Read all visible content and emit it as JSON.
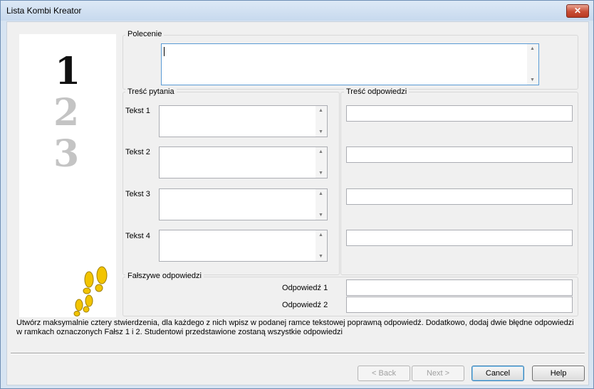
{
  "window": {
    "title": "Lista Kombi Kreator",
    "close_glyph": "✕"
  },
  "image_panel": {
    "digits": [
      "1",
      "2",
      "3"
    ]
  },
  "command": {
    "group_label": "Polecenie",
    "value": ""
  },
  "questions": {
    "group_label": "Treść pytania",
    "items": [
      {
        "label": "Tekst 1",
        "value": ""
      },
      {
        "label": "Tekst 2",
        "value": ""
      },
      {
        "label": "Tekst 3",
        "value": ""
      },
      {
        "label": "Tekst 4",
        "value": ""
      }
    ]
  },
  "answers": {
    "group_label": "Treść odpowiedzi",
    "values": [
      "",
      "",
      "",
      ""
    ]
  },
  "false_answers": {
    "group_label": "Fałszywe odpowiedzi",
    "items": [
      {
        "label": "Odpowiedź 1",
        "value": ""
      },
      {
        "label": "Odpowiedź 2",
        "value": ""
      }
    ]
  },
  "instruction": "Utwórz maksymalnie cztery stwierdzenia, dla każdego z nich wpisz w podanej ramce tekstowej poprawną odpowiedź. Dodatkowo, dodaj dwie błędne odpowiedzi w ramkach oznaczonych Fałsz 1 i 2. Studentowi przedstawione zostaną wszystkie odpowiedzi",
  "buttons": {
    "back": "< Back",
    "next": "Next >",
    "cancel": "Cancel",
    "help": "Help"
  },
  "scroll_glyphs": {
    "up": "▲",
    "down": "▼"
  }
}
